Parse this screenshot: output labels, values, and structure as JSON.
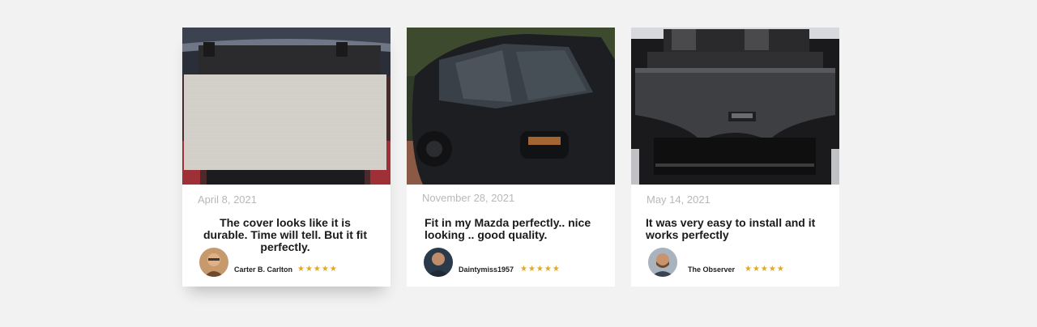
{
  "colors": {
    "background": "#f2f2f2",
    "card": "#ffffff",
    "date_text": "#b8b8b8",
    "review_text": "#1a1a1a",
    "star": "#e5a81b"
  },
  "reviews": [
    {
      "date": "April 8, 2021",
      "text": "The cover looks like it is durable. Time will tell. But it fit perfectly.",
      "author": "Carter B. Carlton",
      "rating": 5,
      "stars": "★★★★★",
      "photo_icon": "cargo-cover-photo",
      "avatar_icon": "avatar-photo"
    },
    {
      "date": "November 28, 2021",
      "text": "Fit in my Mazda perfectly.. nice looking .. good quality.",
      "author": "Daintymiss1957",
      "rating": 5,
      "stars": "★★★★★",
      "photo_icon": "black-suv-photo",
      "avatar_icon": "avatar-photo"
    },
    {
      "date": "May 14, 2021",
      "text": "It was very easy to install and it works perfectly",
      "author": "The Observer",
      "rating": 5,
      "stars": "★★★★★",
      "photo_icon": "trunk-cover-photo",
      "avatar_icon": "avatar-photo"
    }
  ]
}
